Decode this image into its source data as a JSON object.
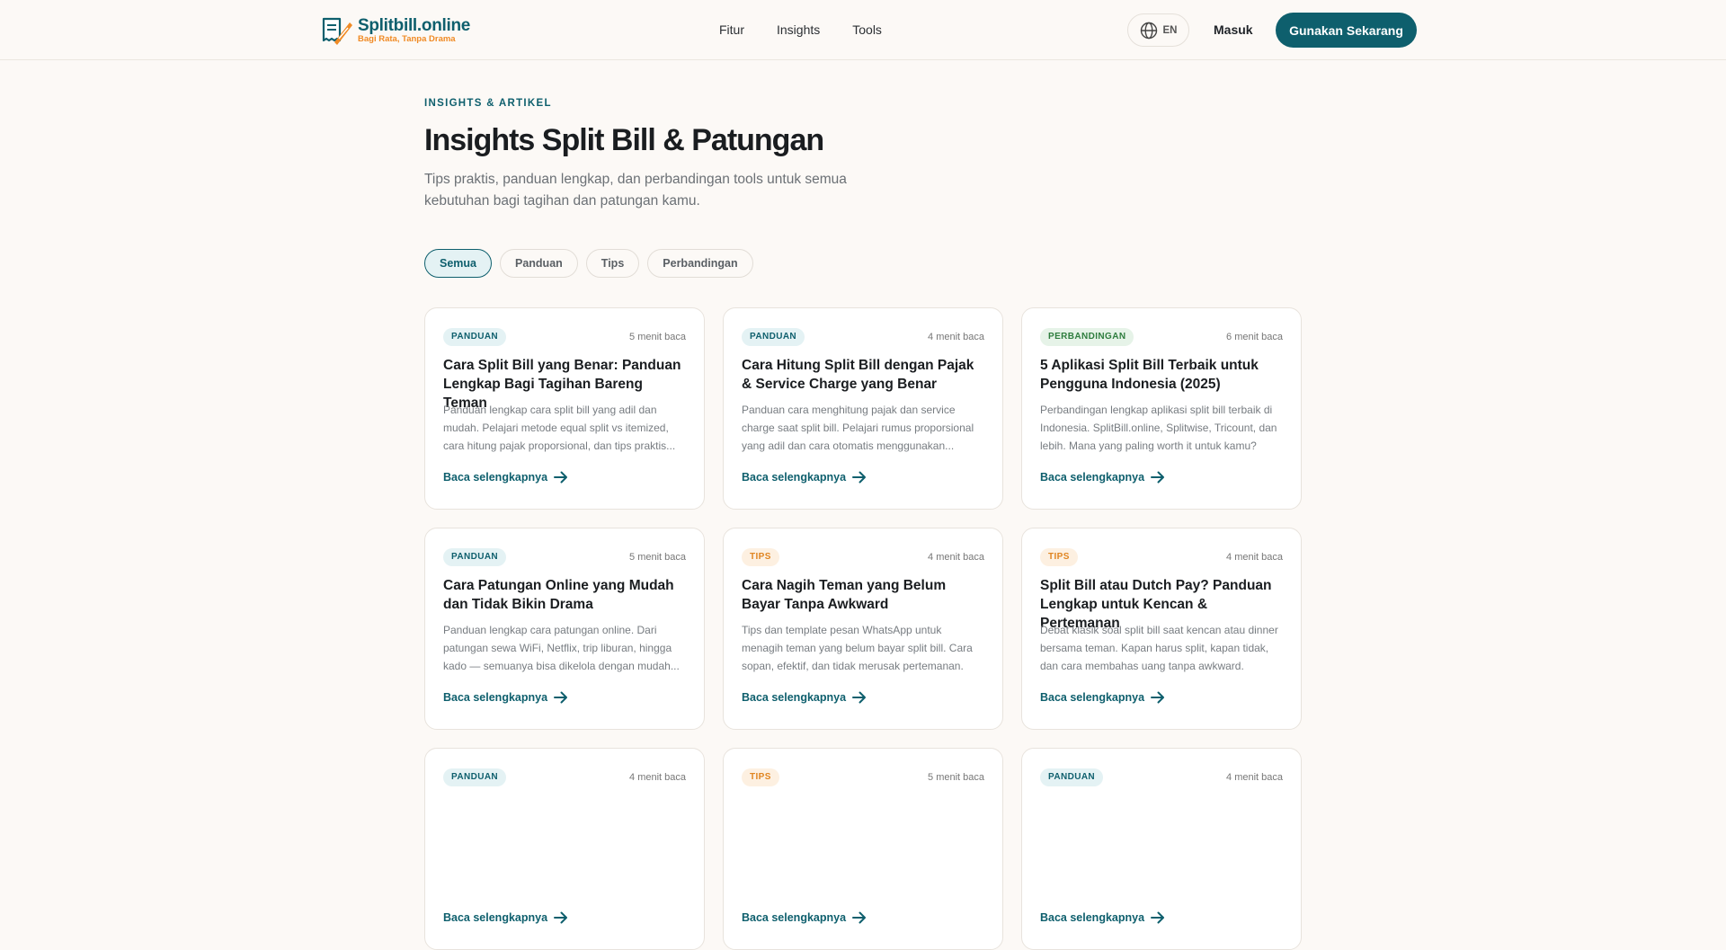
{
  "header": {
    "logo_name": "Splitbill.online",
    "logo_tagline": "Bagi Rata, Tanpa Drama",
    "nav": [
      "Fitur",
      "Insights",
      "Tools"
    ],
    "lang_label": "EN",
    "login_label": "Masuk",
    "cta_label": "Gunakan Sekarang"
  },
  "hero": {
    "eyebrow": "INSIGHTS & ARTIKEL",
    "title": "Insights Split Bill & Patungan",
    "subtitle": "Tips praktis, panduan lengkap, dan perbandingan tools untuk semua kebutuhan bagi tagihan dan patungan kamu."
  },
  "filters": [
    "Semua",
    "Panduan",
    "Tips",
    "Perbandingan"
  ],
  "active_filter": "Semua",
  "read_more_label": "Baca selengkapnya",
  "articles": [
    {
      "category": "PANDUAN",
      "read_time": "5 menit baca",
      "title": "Cara Split Bill yang Benar: Panduan Lengkap Bagi Tagihan Bareng Teman",
      "excerpt": "Panduan lengkap cara split bill yang adil dan mudah. Pelajari metode equal split vs itemized, cara hitung pajak proporsional, dan tips praktis..."
    },
    {
      "category": "PANDUAN",
      "read_time": "4 menit baca",
      "title": "Cara Hitung Split Bill dengan Pajak & Service Charge yang Benar",
      "excerpt": "Panduan cara menghitung pajak dan service charge saat split bill. Pelajari rumus proporsional yang adil dan cara otomatis menggunakan..."
    },
    {
      "category": "PERBANDINGAN",
      "read_time": "6 menit baca",
      "title": "5 Aplikasi Split Bill Terbaik untuk Pengguna Indonesia (2025)",
      "excerpt": "Perbandingan lengkap aplikasi split bill terbaik di Indonesia. SplitBill.online, Splitwise, Tricount, dan lebih. Mana yang paling worth it untuk kamu?"
    },
    {
      "category": "PANDUAN",
      "read_time": "5 menit baca",
      "title": "Cara Patungan Online yang Mudah dan Tidak Bikin Drama",
      "excerpt": "Panduan lengkap cara patungan online. Dari patungan sewa WiFi, Netflix, trip liburan, hingga kado — semuanya bisa dikelola dengan mudah..."
    },
    {
      "category": "TIPS",
      "read_time": "4 menit baca",
      "title": "Cara Nagih Teman yang Belum Bayar Tanpa Awkward",
      "excerpt": "Tips dan template pesan WhatsApp untuk menagih teman yang belum bayar split bill. Cara sopan, efektif, dan tidak merusak pertemanan."
    },
    {
      "category": "TIPS",
      "read_time": "4 menit baca",
      "title": "Split Bill atau Dutch Pay? Panduan Lengkap untuk Kencan & Pertemanan",
      "excerpt": "Debat klasik soal split bill saat kencan atau dinner bersama teman. Kapan harus split, kapan tidak, dan cara membahas uang tanpa awkward."
    },
    {
      "category": "PANDUAN",
      "read_time": "4 menit baca",
      "title": "",
      "excerpt": ""
    },
    {
      "category": "TIPS",
      "read_time": "5 menit baca",
      "title": "",
      "excerpt": ""
    },
    {
      "category": "PANDUAN",
      "read_time": "4 menit baca",
      "title": "",
      "excerpt": ""
    }
  ]
}
